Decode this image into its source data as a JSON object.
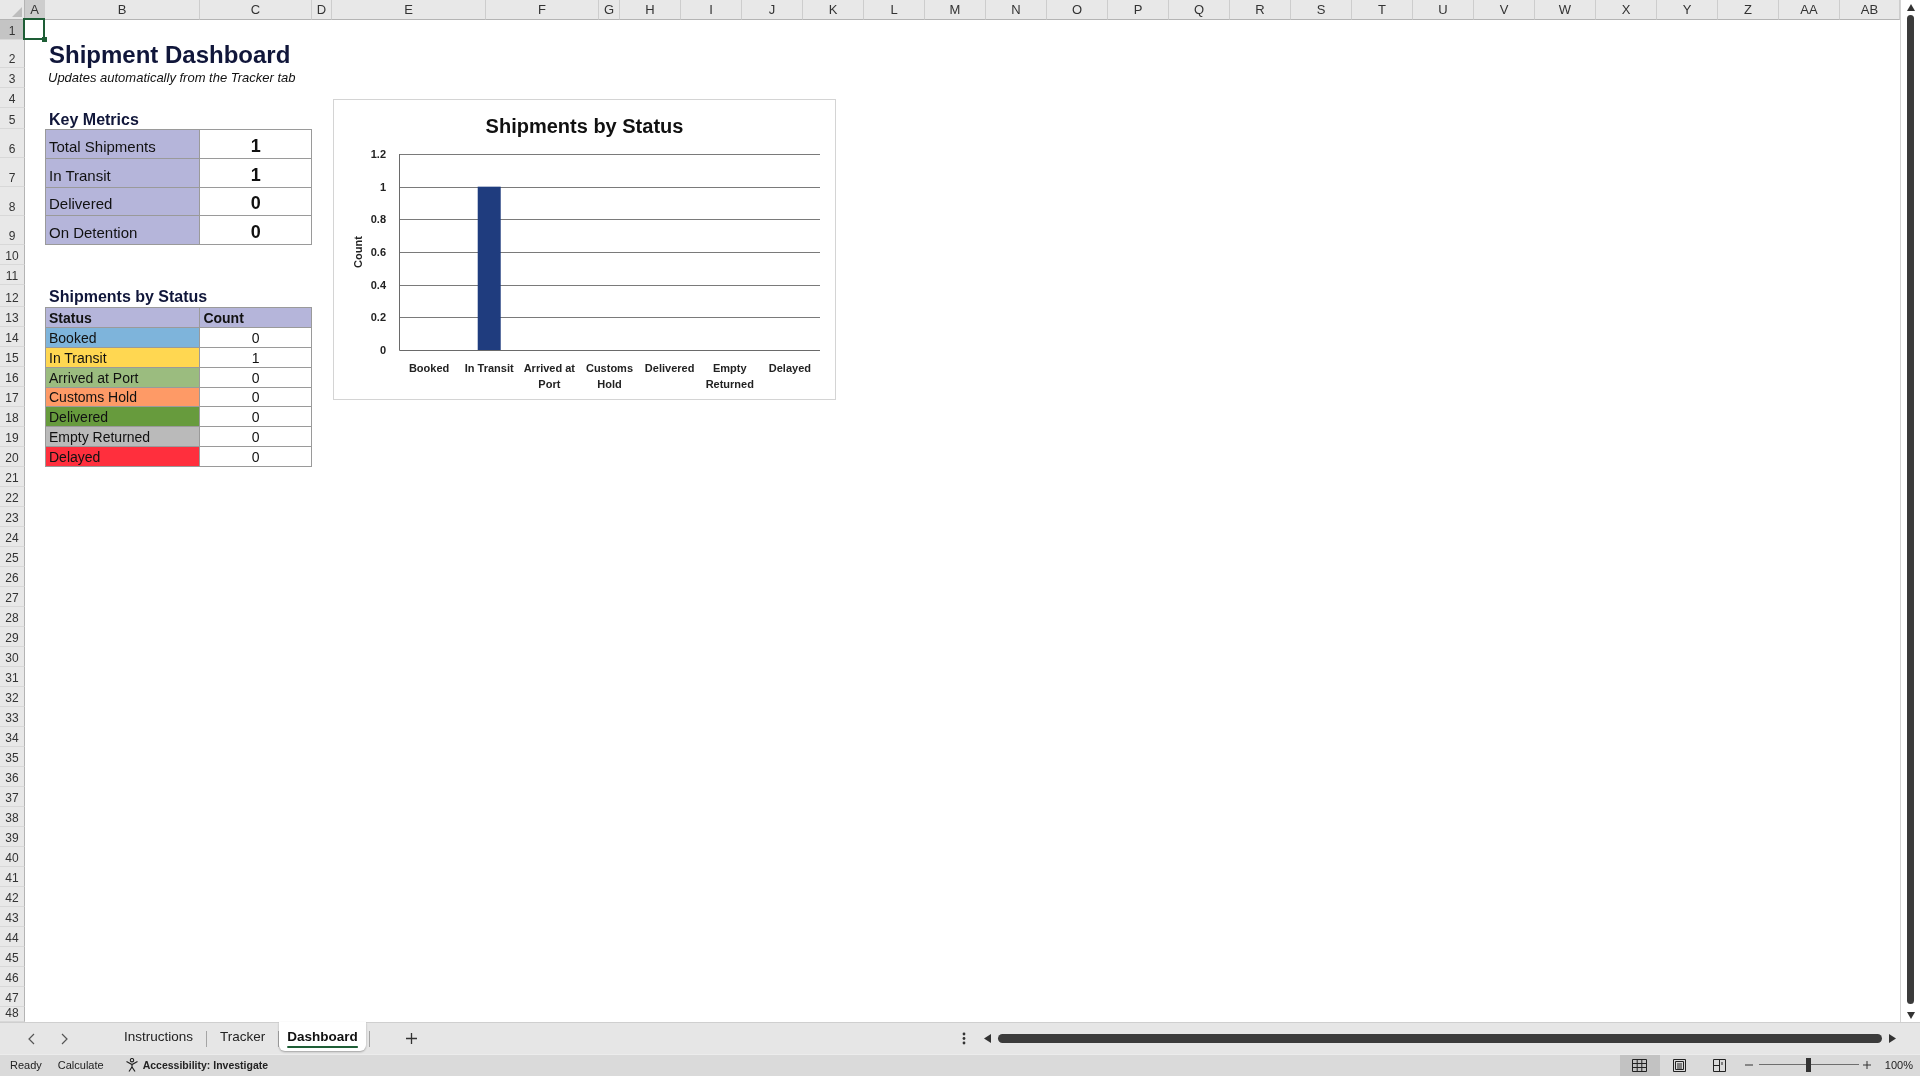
{
  "spreadsheet": {
    "columns": [
      {
        "label": "A",
        "selected": true
      },
      {
        "label": "B",
        "selected": false
      },
      {
        "label": "C",
        "selected": false
      },
      {
        "label": "D",
        "selected": false
      },
      {
        "label": "E",
        "selected": false
      },
      {
        "label": "F",
        "selected": false
      },
      {
        "label": "G",
        "selected": false
      },
      {
        "label": "H",
        "selected": false
      },
      {
        "label": "I",
        "selected": false
      },
      {
        "label": "J",
        "selected": false
      },
      {
        "label": "K",
        "selected": false
      },
      {
        "label": "L",
        "selected": false
      },
      {
        "label": "M",
        "selected": false
      },
      {
        "label": "N",
        "selected": false
      },
      {
        "label": "O",
        "selected": false
      },
      {
        "label": "P",
        "selected": false
      },
      {
        "label": "Q",
        "selected": false
      },
      {
        "label": "R",
        "selected": false
      },
      {
        "label": "S",
        "selected": false
      },
      {
        "label": "T",
        "selected": false
      },
      {
        "label": "U",
        "selected": false
      },
      {
        "label": "V",
        "selected": false
      },
      {
        "label": "W",
        "selected": false
      },
      {
        "label": "X",
        "selected": false
      },
      {
        "label": "Y",
        "selected": false
      },
      {
        "label": "Z",
        "selected": false
      },
      {
        "label": "AA",
        "selected": false
      },
      {
        "label": "AB",
        "selected": false
      }
    ],
    "rows": [
      {
        "label": "1",
        "selected": true
      },
      {
        "label": "2",
        "selected": false
      },
      {
        "label": "3",
        "selected": false
      },
      {
        "label": "4",
        "selected": false
      },
      {
        "label": "5",
        "selected": false
      },
      {
        "label": "6",
        "selected": false
      },
      {
        "label": "7",
        "selected": false
      },
      {
        "label": "8",
        "selected": false
      },
      {
        "label": "9",
        "selected": false
      },
      {
        "label": "10",
        "selected": false
      },
      {
        "label": "11",
        "selected": false
      },
      {
        "label": "12",
        "selected": false
      },
      {
        "label": "13",
        "selected": false
      },
      {
        "label": "14",
        "selected": false
      },
      {
        "label": "15",
        "selected": false
      },
      {
        "label": "16",
        "selected": false
      },
      {
        "label": "17",
        "selected": false
      },
      {
        "label": "18",
        "selected": false
      },
      {
        "label": "19",
        "selected": false
      },
      {
        "label": "20",
        "selected": false
      },
      {
        "label": "21",
        "selected": false
      },
      {
        "label": "22",
        "selected": false
      },
      {
        "label": "23",
        "selected": false
      },
      {
        "label": "24",
        "selected": false
      },
      {
        "label": "25",
        "selected": false
      },
      {
        "label": "26",
        "selected": false
      },
      {
        "label": "27",
        "selected": false
      },
      {
        "label": "28",
        "selected": false
      },
      {
        "label": "29",
        "selected": false
      },
      {
        "label": "30",
        "selected": false
      },
      {
        "label": "31",
        "selected": false
      },
      {
        "label": "32",
        "selected": false
      },
      {
        "label": "33",
        "selected": false
      },
      {
        "label": "34",
        "selected": false
      },
      {
        "label": "35",
        "selected": false
      },
      {
        "label": "36",
        "selected": false
      },
      {
        "label": "37",
        "selected": false
      },
      {
        "label": "38",
        "selected": false
      },
      {
        "label": "39",
        "selected": false
      },
      {
        "label": "40",
        "selected": false
      },
      {
        "label": "41",
        "selected": false
      },
      {
        "label": "42",
        "selected": false
      },
      {
        "label": "43",
        "selected": false
      },
      {
        "label": "44",
        "selected": false
      },
      {
        "label": "45",
        "selected": false
      },
      {
        "label": "46",
        "selected": false
      },
      {
        "label": "47",
        "selected": false
      },
      {
        "label": "48",
        "selected": false
      }
    ]
  },
  "title": "Shipment Dashboard",
  "subtitle": "Updates automatically from the Tracker tab",
  "key_metrics": {
    "heading": "Key Metrics",
    "rows": [
      {
        "label": "Total Shipments",
        "value": "1"
      },
      {
        "label": "In Transit",
        "value": "1"
      },
      {
        "label": "Delivered",
        "value": "0"
      },
      {
        "label": "On Detention",
        "value": "0"
      }
    ]
  },
  "status_table": {
    "heading": "Shipments by Status",
    "columns": [
      "Status",
      "Count"
    ],
    "rows": [
      {
        "status": "Booked",
        "count": "0",
        "color": "#7eb4db"
      },
      {
        "status": "In Transit",
        "count": "1",
        "color": "#ffd751"
      },
      {
        "status": "Arrived at Port",
        "count": "0",
        "color": "#9bbc7f"
      },
      {
        "status": "Customs Hold",
        "count": "0",
        "color": "#fe9a66"
      },
      {
        "status": "Delivered",
        "count": "0",
        "color": "#679b3d"
      },
      {
        "status": "Empty Returned",
        "count": "0",
        "color": "#bababa"
      },
      {
        "status": "Delayed",
        "count": "0",
        "color": "#ff2f3d"
      }
    ]
  },
  "chart": {
    "chart_data": {
      "type": "bar",
      "title": "Shipments by Status",
      "ylabel": "Count",
      "categories": [
        "Booked",
        "In Transit",
        "Arrived at Port",
        "Customs Hold",
        "Delivered",
        "Empty Returned",
        "Delayed"
      ],
      "values": [
        0,
        1,
        0,
        0,
        0,
        0,
        0
      ],
      "ylim": [
        0,
        1.2
      ],
      "yticks": [
        0,
        0.2,
        0.4,
        0.6,
        0.8,
        1,
        1.2
      ],
      "grid": true
    }
  },
  "sheet_tabs": [
    {
      "label": "Instructions",
      "selected": false
    },
    {
      "label": "Tracker",
      "selected": false
    },
    {
      "label": "Dashboard",
      "selected": true
    }
  ],
  "status_bar": {
    "mode": "Ready",
    "calculate": "Calculate",
    "accessibility": "Accessibility: Investigate",
    "view_buttons": [
      {
        "kind": "normal",
        "selected": true
      },
      {
        "kind": "page_layout",
        "selected": false
      },
      {
        "kind": "page_break",
        "selected": false
      }
    ],
    "zoom": {
      "level": 0.5,
      "reading": "100%"
    }
  }
}
